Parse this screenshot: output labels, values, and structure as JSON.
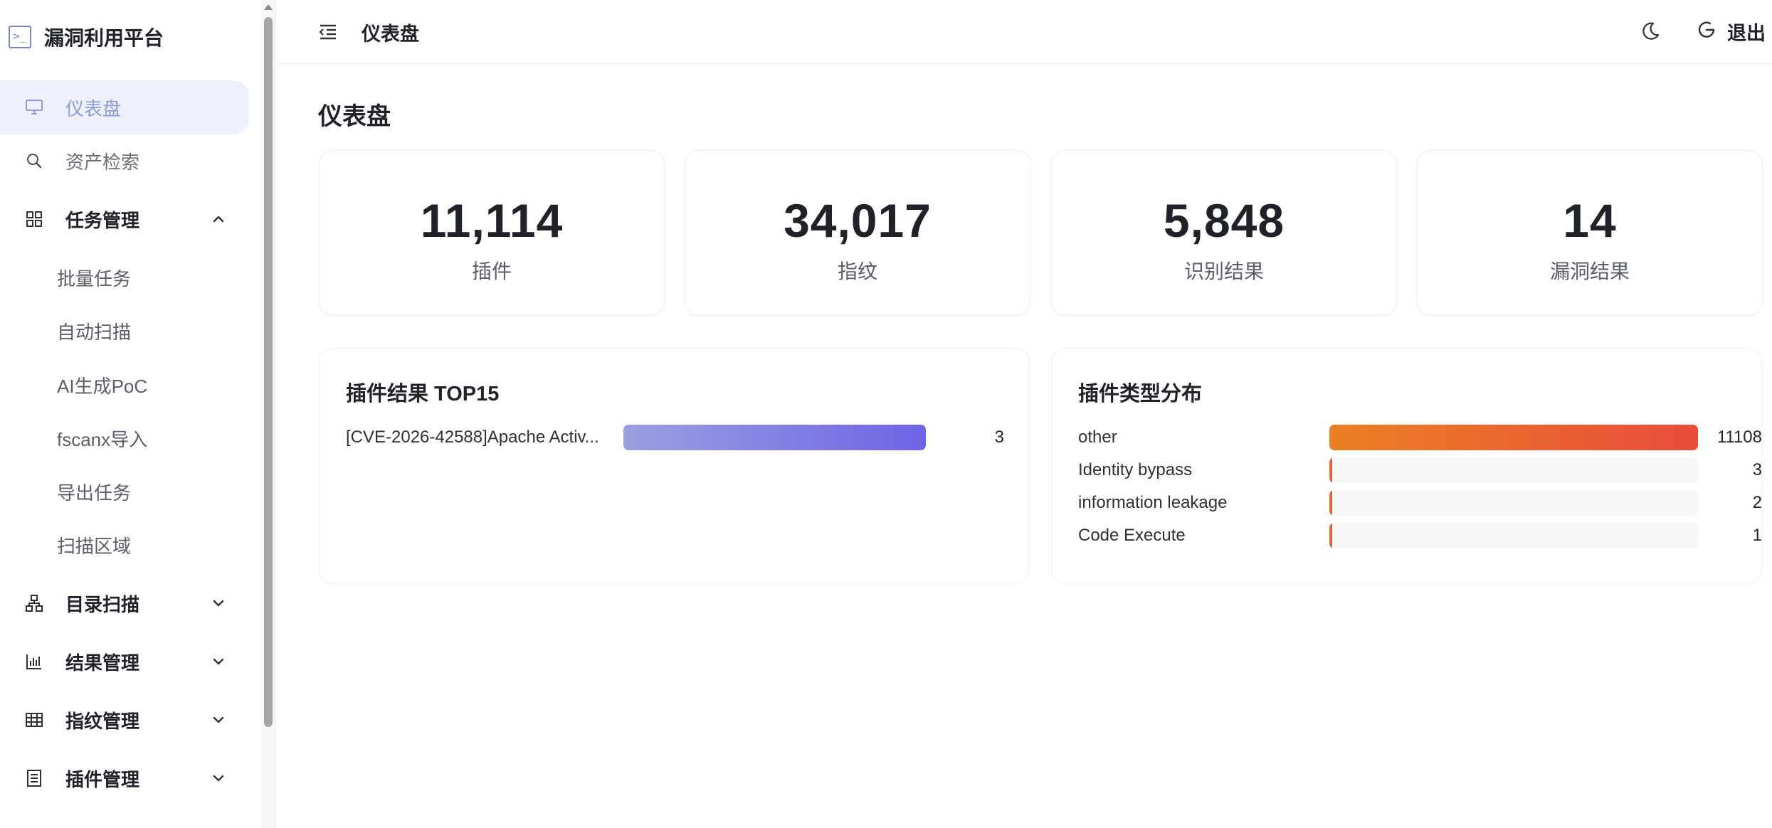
{
  "app": {
    "title": "漏洞利用平台"
  },
  "sidebar": {
    "items": [
      {
        "label": "仪表盘",
        "icon": "monitor-icon",
        "active": true
      },
      {
        "label": "资产检索",
        "icon": "search-icon"
      },
      {
        "label": "任务管理",
        "icon": "grid-icon",
        "expanded": true,
        "children": [
          "批量任务",
          "自动扫描",
          "AI生成PoC",
          "fscanx导入",
          "导出任务",
          "扫描区域"
        ]
      },
      {
        "label": "目录扫描",
        "icon": "sitemap-icon",
        "expanded": false
      },
      {
        "label": "结果管理",
        "icon": "bar-chart-icon",
        "expanded": false
      },
      {
        "label": "指纹管理",
        "icon": "table-icon",
        "expanded": false
      },
      {
        "label": "插件管理",
        "icon": "document-list-icon",
        "expanded": false
      }
    ]
  },
  "header": {
    "title": "仪表盘",
    "logout_label": "退出",
    "theme_icon": "moon-icon",
    "logout_icon": "power-icon",
    "collapse_icon": "indent-icon"
  },
  "main": {
    "page_title": "仪表盘",
    "stats": [
      {
        "value": "11,114",
        "label": "插件"
      },
      {
        "value": "34,017",
        "label": "指纹"
      },
      {
        "value": "5,848",
        "label": "识别结果"
      },
      {
        "value": "14",
        "label": "漏洞结果"
      }
    ]
  },
  "chart_data": [
    {
      "type": "bar",
      "title": "插件结果 TOP15",
      "categories": [
        "[CVE-2026-42588]Apache Activ..."
      ],
      "values": [
        3
      ],
      "colors": [
        "#9aa0e0",
        "#6f63e6"
      ]
    },
    {
      "type": "bar",
      "title": "插件类型分布",
      "categories": [
        "other",
        "Identity bypass",
        "information leakage",
        "Code Execute"
      ],
      "values": [
        11108,
        3,
        2,
        1
      ],
      "colors": [
        "#ec8024",
        "#e74c3c"
      ]
    }
  ]
}
